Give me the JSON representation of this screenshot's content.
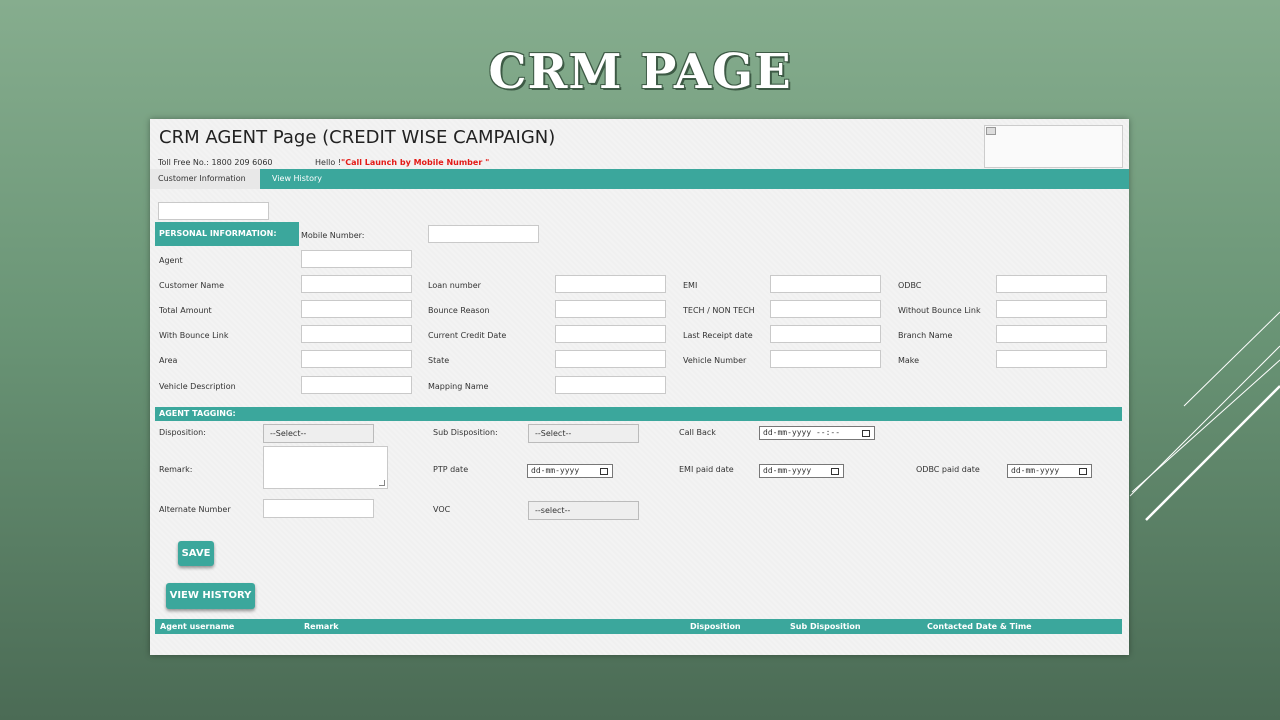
{
  "slide_title": "CRM PAGE",
  "page": {
    "heading": "CRM AGENT Page (CREDIT WISE CAMPAIGN)",
    "toll_free": "Toll Free No.: 1800 209 6060",
    "hello_prefix": "Hello !",
    "hello_value": "\"Call Launch by Mobile Number \""
  },
  "tabs": [
    {
      "label": "Customer Information",
      "active": true
    },
    {
      "label": "View History",
      "active": false
    }
  ],
  "personal": {
    "section_title": "PERSONAL INFORMATION:",
    "mobile_label": "Mobile Number:",
    "agent_label": "Agent",
    "fields": [
      "Customer Name",
      "Loan number",
      "EMI",
      "ODBC",
      "Total Amount",
      "Bounce Reason",
      "TECH / NON TECH",
      "Without Bounce Link",
      "With Bounce Link",
      "Current Credit Date",
      "Last Receipt date",
      "Branch Name",
      "Area",
      "State",
      "Vehicle Number",
      "Make",
      "Vehicle Description",
      "Mapping Name"
    ]
  },
  "tagging": {
    "section_title": "AGENT TAGGING:",
    "disposition_label": "Disposition:",
    "disposition_value": "--Select--",
    "sub_disposition_label": "Sub Disposition:",
    "sub_disposition_value": "--Select--",
    "call_back_label": "Call Back",
    "call_back_value": "dd-mm-yyyy --:--",
    "remark_label": "Remark:",
    "ptp_label": "PTP date",
    "ptp_value": "dd-mm-yyyy",
    "emi_paid_label": "EMI paid date",
    "emi_paid_value": "dd-mm-yyyy",
    "odbc_paid_label": "ODBC paid date",
    "odbc_paid_value": "dd-mm-yyyy",
    "alt_number_label": "Alternate Number",
    "voc_label": "VOC",
    "voc_value": "--select--"
  },
  "buttons": {
    "save": "SAVE",
    "view_history": "VIEW HISTORY"
  },
  "history_columns": [
    "Agent username",
    "Remark",
    "Disposition",
    "Sub Disposition",
    "Contacted Date & Time"
  ],
  "colors": {
    "accent": "#3ba79c",
    "hello": "#e41b17"
  }
}
